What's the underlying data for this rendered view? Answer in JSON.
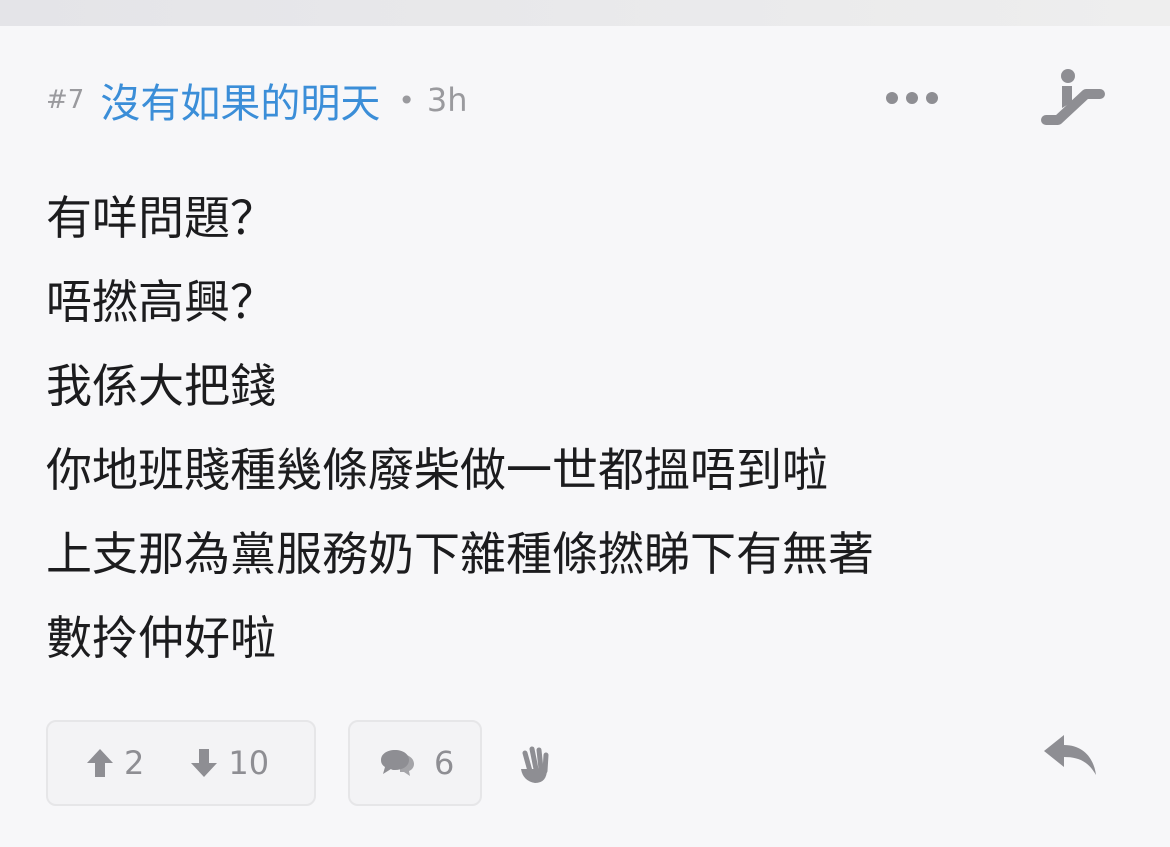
{
  "post": {
    "floor": "#7",
    "username": "沒有如果的明天",
    "separator": "•",
    "time": "3h",
    "content_lines": [
      "有咩問題？",
      "唔撚高興？",
      "我係大把錢",
      "你地班賤種幾條廢柴做一世都搵唔到啦",
      "上支那為黨服務奶下雜種條撚睇下有無著",
      "數拎仲好啦"
    ]
  },
  "actions": {
    "upvotes": "2",
    "downvotes": "10",
    "replies": "6"
  },
  "icons": {
    "more": "more-dots-icon",
    "escalator": "escalator-icon",
    "upvote": "arrow-up-icon",
    "downvote": "arrow-down-icon",
    "replies": "speech-bubbles-icon",
    "hand": "hand-icon",
    "quote": "reply-arrow-icon"
  },
  "colors": {
    "username": "#3b8ed8",
    "meta": "#9a9a9e",
    "text": "#1c1c1e",
    "icon": "#8e8e93",
    "background": "#f7f7f9"
  }
}
